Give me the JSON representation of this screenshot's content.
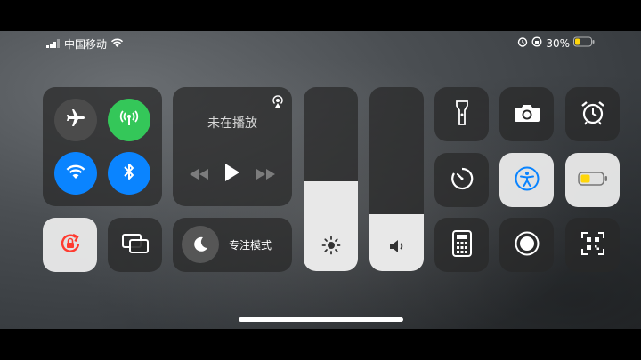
{
  "status_bar": {
    "carrier": "中国移动",
    "battery_percent": "30%",
    "battery_level": 0.3
  },
  "connectivity": {
    "airplane": {
      "icon": "airplane-icon",
      "active": false
    },
    "cellular": {
      "icon": "antenna-icon",
      "active": true,
      "color": "#34c759"
    },
    "wifi": {
      "icon": "wifi-icon",
      "active": true,
      "color": "#0a84ff"
    },
    "bluetooth": {
      "icon": "bluetooth-icon",
      "active": true,
      "color": "#0a84ff"
    }
  },
  "now_playing": {
    "title": "未在播放",
    "airplay_icon": "airplay-icon"
  },
  "focus": {
    "label": "专注模式",
    "icon": "moon-icon"
  },
  "brightness": {
    "level": 0.49,
    "icon": "sun-icon"
  },
  "volume": {
    "level": 0.31,
    "icon": "speaker-icon"
  },
  "tiles": [
    "flashlight-icon",
    "camera-icon",
    "alarm-icon",
    "timer-icon",
    "accessibility-icon",
    "battery-icon",
    "calculator-icon",
    "record-icon",
    "qr-code-icon"
  ],
  "colors": {
    "accent_green": "#34c759",
    "accent_blue": "#0a84ff",
    "lock_red": "#ff3b30",
    "battery_yellow": "#ffd60a"
  }
}
